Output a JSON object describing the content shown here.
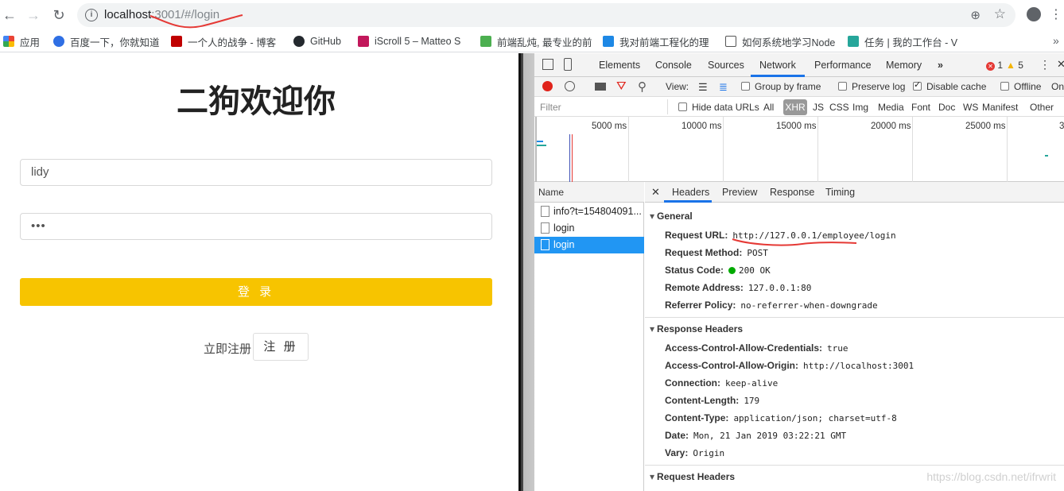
{
  "browser": {
    "url_host": "localhost",
    "url_rest": ":3001/#/login"
  },
  "bookmarks": [
    {
      "label": "应用",
      "color": "#e94235"
    },
    {
      "label": "百度一下，你就知道",
      "color": "#2f6fe4"
    },
    {
      "label": "一个人的战争 - 博客",
      "color": "#c00000"
    },
    {
      "label": "GitHub",
      "color": "#24292e"
    },
    {
      "label": "iScroll 5 – Matteo S",
      "color": "#c2185b"
    },
    {
      "label": "前端乱炖, 最专业的前",
      "color": "#4caf50"
    },
    {
      "label": "我对前端工程化的理",
      "color": "#1e88e5"
    },
    {
      "label": "如何系统地学习Node",
      "color": "#555555"
    },
    {
      "label": "任务 | 我的工作台 - V",
      "color": "#26a69a"
    }
  ],
  "page": {
    "title": "二狗欢迎你",
    "username_value": "lidy",
    "password_value": "•••",
    "login_button": "登 录",
    "register_prompt": "立即注册",
    "register_button": "注 册"
  },
  "devtools": {
    "tabs": [
      "Elements",
      "Console",
      "Sources",
      "Network",
      "Performance",
      "Memory",
      "»"
    ],
    "active_tab": "Network",
    "error_count": "1",
    "warning_count": "5",
    "controls": {
      "view_label": "View:",
      "group_by_frame": "Group by frame",
      "preserve_log": "Preserve log",
      "disable_cache": "Disable cache",
      "offline": "Offline",
      "online": "On"
    },
    "filter": {
      "placeholder": "Filter",
      "hide_data_urls": "Hide data URLs",
      "types": [
        "All",
        "XHR",
        "JS",
        "CSS",
        "Img",
        "Media",
        "Font",
        "Doc",
        "WS",
        "Manifest",
        "Other"
      ],
      "active_type": "XHR"
    },
    "timeline_labels": [
      "5000 ms",
      "10000 ms",
      "15000 ms",
      "20000 ms",
      "25000 ms",
      "3"
    ],
    "name_header": "Name",
    "requests": [
      {
        "name": "info?t=154804091..."
      },
      {
        "name": "login"
      },
      {
        "name": "login"
      }
    ],
    "detail_tabs": [
      "Headers",
      "Preview",
      "Response",
      "Timing"
    ],
    "general_title": "General",
    "general": [
      {
        "key": "Request URL:",
        "value": "http://127.0.0.1/employee/login"
      },
      {
        "key": "Request Method:",
        "value": "POST"
      },
      {
        "key": "Status Code:",
        "value": "200 OK"
      },
      {
        "key": "Remote Address:",
        "value": "127.0.0.1:80"
      },
      {
        "key": "Referrer Policy:",
        "value": "no-referrer-when-downgrade"
      }
    ],
    "response_headers_title": "Response Headers",
    "response_headers": [
      {
        "key": "Access-Control-Allow-Credentials:",
        "value": "true"
      },
      {
        "key": "Access-Control-Allow-Origin:",
        "value": "http://localhost:3001"
      },
      {
        "key": "Connection:",
        "value": "keep-alive"
      },
      {
        "key": "Content-Length:",
        "value": "179"
      },
      {
        "key": "Content-Type:",
        "value": "application/json; charset=utf-8"
      },
      {
        "key": "Date:",
        "value": "Mon, 21 Jan 2019 03:22:21 GMT"
      },
      {
        "key": "Vary:",
        "value": "Origin"
      }
    ],
    "request_headers_title": "Request Headers"
  },
  "watermark": "https://blog.csdn.net/ifrwrit"
}
